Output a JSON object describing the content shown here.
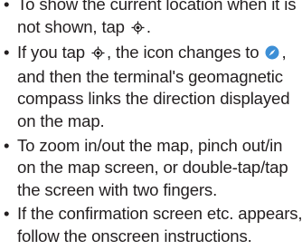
{
  "bullet_char": "•",
  "items": [
    {
      "lines": [
        {
          "pre": "To show the current location when it is"
        },
        {
          "pre": "not shown, tap ",
          "icon": "locate-icon",
          "post": "."
        }
      ]
    },
    {
      "lines": [
        {
          "pre": "If you tap ",
          "icon": "locate-icon",
          "post": ", the icon changes to ",
          "icon2": "compass-icon",
          "post2": ","
        },
        {
          "pre": "and then the terminal's geomagnetic"
        },
        {
          "pre": "compass links the direction displayed"
        },
        {
          "pre": "on the map."
        }
      ]
    },
    {
      "lines": [
        {
          "pre": "To zoom in/out the map, pinch out/in"
        },
        {
          "pre": "on the map screen, or double-tap/tap"
        },
        {
          "pre": "the screen with two fingers."
        }
      ]
    },
    {
      "lines": [
        {
          "pre": "If the confirmation screen etc. appears,"
        },
        {
          "pre": "follow the onscreen instructions."
        }
      ]
    }
  ],
  "colors": {
    "text": "#231f20",
    "locate_icon": "#231f20",
    "compass_icon_bg": "#3d8fd6",
    "compass_needle": "#ffffff"
  }
}
